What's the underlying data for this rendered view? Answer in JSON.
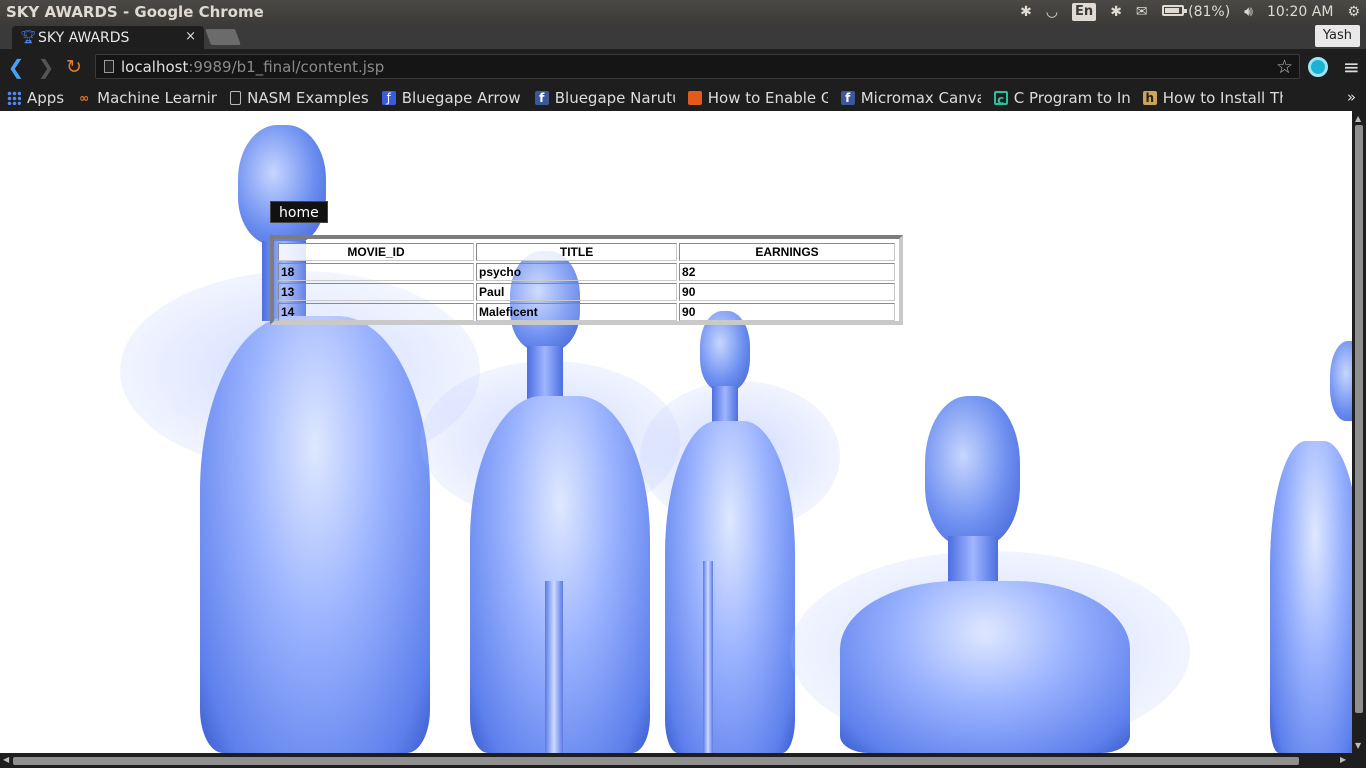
{
  "window": {
    "title": "SKY AWARDS - Google Chrome"
  },
  "tray": {
    "language": "En",
    "battery": "(81%)",
    "clock": "10:20 AM",
    "icons": [
      "bluetooth-icon",
      "wifi-icon",
      "mail-icon",
      "battery-icon",
      "volume-icon",
      "settings-gear-icon"
    ]
  },
  "tab": {
    "title": "SKY AWARDS",
    "close": "×"
  },
  "profile": {
    "name": "Yash"
  },
  "toolbar": {
    "url_host": "localhost",
    "url_rest": ":9989/b1_final/content.jsp"
  },
  "bookmarks": {
    "items": [
      {
        "label": "Apps",
        "icon": "apps-grid-icon"
      },
      {
        "label": "Machine Learning",
        "icon": "infinity-icon"
      },
      {
        "label": "NASM Examples",
        "icon": "page-icon"
      },
      {
        "label": "Bluegape Arrow T",
        "icon": "bluegape-icon"
      },
      {
        "label": "Bluegape Narutu",
        "icon": "facebook-icon"
      },
      {
        "label": "How to Enable Ga",
        "icon": "box-icon"
      },
      {
        "label": "Micromax Canvas",
        "icon": "facebook-icon"
      },
      {
        "label": "C Program to Inpu",
        "icon": "c-circle-icon"
      },
      {
        "label": "How to Install Th",
        "icon": "h-icon"
      }
    ],
    "more": "»"
  },
  "page": {
    "home_label": "home",
    "table": {
      "headers": [
        "MOVIE_ID",
        "TITLE",
        "EARNINGS"
      ],
      "rows": [
        [
          "18",
          "psycho",
          "82"
        ],
        [
          "13",
          "Paul",
          "90"
        ],
        [
          "14",
          "Maleficent",
          "90"
        ]
      ]
    }
  }
}
